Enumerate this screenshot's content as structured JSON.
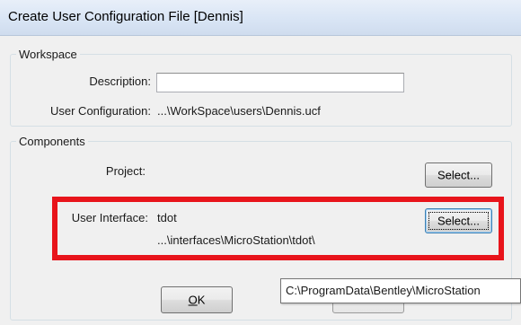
{
  "window": {
    "title": "Create User Configuration File [Dennis]"
  },
  "workspace": {
    "group_title": "Workspace",
    "description_label": "Description:",
    "description_value": "",
    "user_config_label": "User Configuration:",
    "user_config_value": "...\\WorkSpace\\users\\Dennis.ucf"
  },
  "components": {
    "group_title": "Components",
    "project_label": "Project:",
    "project_select_label": "Select...",
    "ui_label": "User Interface:",
    "ui_value": "tdot",
    "ui_path": "...\\interfaces\\MicroStation\\tdot\\",
    "ui_select_label": "Select..."
  },
  "footer": {
    "ok_label": "OK",
    "ok_accelerator": "O",
    "ok_rest": "K"
  },
  "tooltip": {
    "text": "C:\\ProgramData\\Bentley\\MicroStation"
  },
  "colors": {
    "highlight": "#e8141b",
    "titlebar": "#d9e5f5",
    "dialog_bg": "#f0f0f0"
  }
}
